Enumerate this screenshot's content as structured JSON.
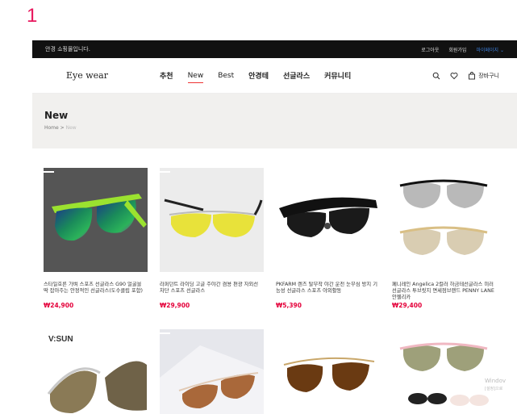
{
  "slide_number": "1",
  "topbar": {
    "welcome": "안경 쇼핑몰입니다.",
    "logout": "로그아웃",
    "join": "회원가입",
    "mypage": "마이페이지 ⌄"
  },
  "nav": {
    "logo": "Eye wear",
    "menu": [
      "추천",
      "New",
      "Best",
      "안경테",
      "선글라스",
      "커뮤니티"
    ],
    "cart_label": "장바구니"
  },
  "banner": {
    "title": "New",
    "crumb_home": "Home",
    "crumb_sep": ">",
    "crumb_current": "New"
  },
  "products": [
    {
      "name": "스타일호른 가벼 스포츠 선글라스 G90 얼굴을 딱 잡아주는 안정적인 선글라스(도수클립 포함)",
      "price": "₩24,900"
    },
    {
      "name": "라퍼던트 라이딩 고글 주야간 겸용 편광 자외선 차단 스포츠 선글라스",
      "price": "₩29,900"
    },
    {
      "name": "PKFARM 렌즈 탈부착 야간 운전 눈부심 방지 기능성 선글라스 스포츠 야외활동",
      "price": "₩5,390"
    },
    {
      "name": "페니레인 Angelica 2컬러 하금테선글라스 미러선글라스 투브릿지 면세점브랜드 PENNY LANE 안젤리카",
      "price": "₩29,400"
    },
    {
      "name": "",
      "price": ""
    },
    {
      "name": "",
      "price": ""
    },
    {
      "name": "",
      "price": ""
    },
    {
      "name": "",
      "price": ""
    }
  ],
  "brand_text": "V:SUN",
  "watermark": {
    "line1": "Windov",
    "line2": "[설정]으로"
  },
  "colors": {
    "accent": "#e33",
    "price": "#e4003a",
    "slide_number": "#e8175d",
    "topbar_bg": "#111111",
    "banner_bg": "#f1f0ee"
  }
}
